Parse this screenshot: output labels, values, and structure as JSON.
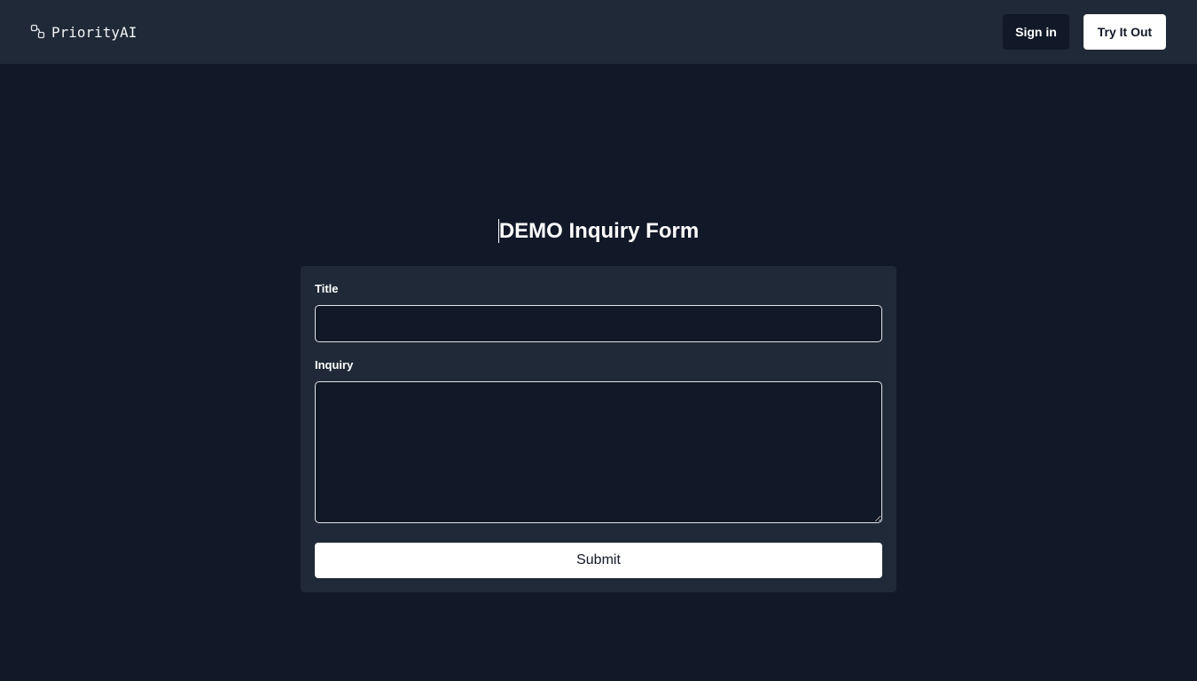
{
  "header": {
    "brand_icon": "link-icon",
    "brand_name": "PriorityAI",
    "sign_in_label": "Sign in",
    "try_label": "Try It Out"
  },
  "main": {
    "heading": "DEMO Inquiry Form",
    "form": {
      "title_label": "Title",
      "title_value": "",
      "inquiry_label": "Inquiry",
      "inquiry_value": "",
      "submit_label": "Submit"
    }
  },
  "colors": {
    "page_background": "#111827",
    "panel_background": "#1f2937",
    "primary_button": "#ffffff",
    "dark_button": "#111827"
  }
}
